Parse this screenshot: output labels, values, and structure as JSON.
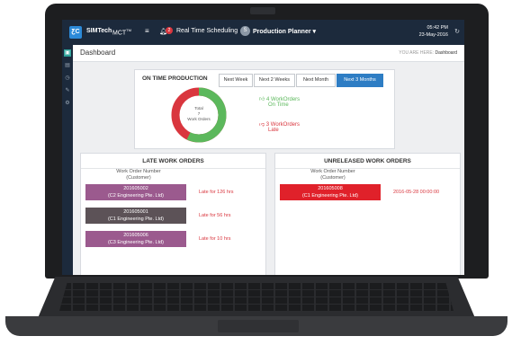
{
  "header": {
    "brand": "SIMTech",
    "product": "MCT",
    "product_sup": "TM",
    "notification_count": "2",
    "nav_title": "Real Time Scheduling",
    "user_initial": "S",
    "user_role": "Production Planner",
    "time": "05:42 PM",
    "date": "23-May-2016"
  },
  "page": {
    "title": "Dashboard",
    "breadcrumb_prefix": "YOU ARE HERE:",
    "breadcrumb_current": "Dashboard"
  },
  "on_time": {
    "title": "ON TIME PRODUCTION",
    "center_line1": "Total",
    "center_line2": "7",
    "center_line3": "Work Orders",
    "on_time_count": "4 WorkOrders",
    "on_time_label": "On Time",
    "late_count": "3 WorkOrders",
    "late_label": "Late",
    "colors": {
      "on_time": "#5cb85c",
      "late": "#d9363e"
    },
    "buttons": [
      "Next Week",
      "Next 2 Weeks",
      "Next Month",
      "Next 3 Months"
    ],
    "active_button": "Next 3 Months"
  },
  "late_orders": {
    "title": "LATE WORK ORDERS",
    "col_line1": "Work Order Number",
    "col_line2": "(Customer)",
    "rows": [
      {
        "number": "201605002",
        "customer": "(C2 Engineering Pte. Ltd)",
        "status": "Late for 126 hrs",
        "color": "#9b5a8e"
      },
      {
        "number": "201605001",
        "customer": "(C1 Engineering Pte. Ltd)",
        "status": "Late for 56 hrs",
        "color": "#5c5257"
      },
      {
        "number": "201605006",
        "customer": "(C3 Engineering Pte. Ltd)",
        "status": "Late for 10 hrs",
        "color": "#9b5a8e"
      }
    ]
  },
  "unreleased_orders": {
    "title": "UNRELEASED WORK ORDERS",
    "col_line1": "Work Order Number",
    "col_line2": "(Customer)",
    "rows": [
      {
        "number": "201605008",
        "customer": "(C1 Engineering Pte. Ltd)",
        "date": "2016-05-28 00:00:00",
        "color": "#e0212a"
      }
    ]
  }
}
